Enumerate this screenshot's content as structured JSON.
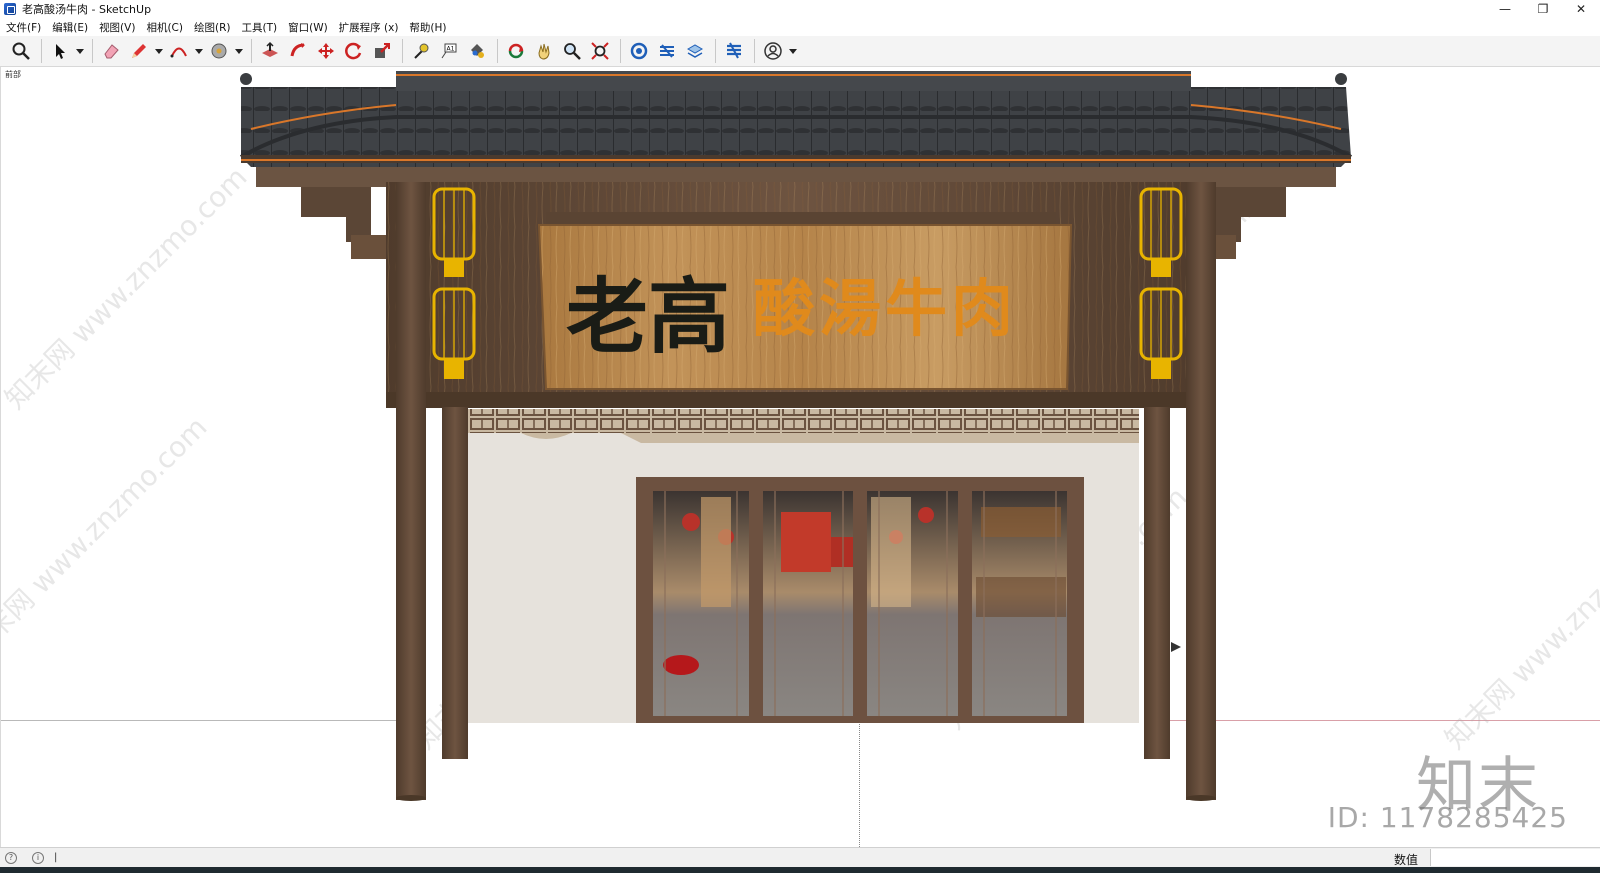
{
  "window": {
    "title": "老高酸汤牛肉 - SketchUp",
    "minimize": "—",
    "maximize": "❐",
    "close": "✕"
  },
  "menu": [
    {
      "label": "文件(F)"
    },
    {
      "label": "编辑(E)"
    },
    {
      "label": "视图(V)"
    },
    {
      "label": "相机(C)"
    },
    {
      "label": "绘图(R)"
    },
    {
      "label": "工具(T)"
    },
    {
      "label": "窗口(W)"
    },
    {
      "label": "扩展程序 (x)"
    },
    {
      "label": "帮助(H)"
    }
  ],
  "toolbar": [
    "zoom-extents-icon",
    "select-icon",
    "eraser-icon",
    "pencil-icon",
    "arc-icon",
    "circle-icon",
    "push-pull-icon",
    "follow-me-icon",
    "move-icon",
    "rotate-icon",
    "scale-icon",
    "tape-measure-icon",
    "text-icon",
    "paint-bucket-icon",
    "orbit-icon",
    "pan-icon",
    "zoom-icon",
    "zoom-window-icon",
    "warehouse-icon",
    "extension-warehouse-icon",
    "layout-icon",
    "extension-manager-icon",
    "account-icon"
  ],
  "viewport": {
    "scene_label": "前部",
    "sign_text_dark": "老高",
    "sign_text_orange": "酸湯牛肉",
    "watermark_logo": "知末",
    "watermark_id": "ID: 1178285425",
    "watermark_diagonal": "知末网 www.znzmo.com"
  },
  "status": {
    "value_label": "数值",
    "value": ""
  },
  "colors": {
    "roof_tile": "#3a3d40",
    "wood_dark": "#5e4735",
    "wood_sign": "#b98a52",
    "calligraphy_dark": "#1a1c16",
    "calligraphy_orange": "#e08a1c",
    "lantern_gold": "#e8b400",
    "wall_plaster": "#e6e2dc"
  }
}
